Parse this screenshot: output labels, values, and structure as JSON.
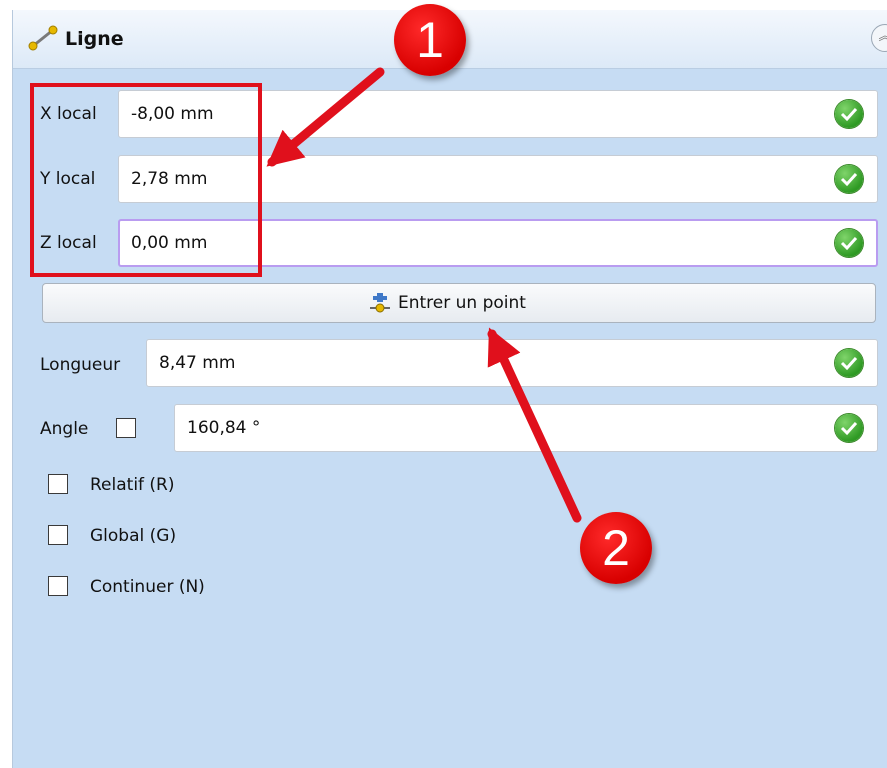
{
  "panel": {
    "title": "Ligne",
    "collapse_icon": "double-chevron-up-icon"
  },
  "fields": {
    "x_local": {
      "label": "X local",
      "value": "-8,00 mm"
    },
    "y_local": {
      "label": "Y local",
      "value": "2,78 mm"
    },
    "z_local": {
      "label": "Z local",
      "value": "0,00 mm"
    },
    "longueur": {
      "label": "Longueur",
      "value": "8,47 mm"
    },
    "angle": {
      "label": "Angle",
      "value": "160,84 °"
    }
  },
  "enter_point_button": {
    "label": "Entrer un point",
    "icon": "point-icon"
  },
  "options": {
    "relatif": "Relatif (R)",
    "global": "Global (G)",
    "continuer": "Continuer (N)"
  },
  "annotations": {
    "badge_1": "1",
    "badge_2": "2",
    "color": "#e0101c"
  },
  "colors": {
    "panel_bg": "#c6dcf3",
    "focus_border": "#b99cf0",
    "ok_green": "#2f9a24"
  }
}
